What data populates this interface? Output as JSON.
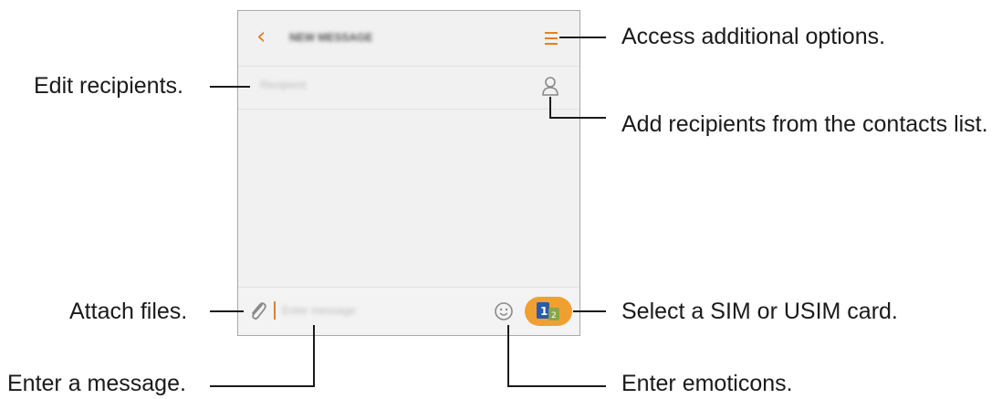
{
  "phone": {
    "header_title": "NEW MESSAGE",
    "recipient_placeholder": "Recipient",
    "message_placeholder": "Enter message",
    "icons": {
      "back": "chevron-left-icon",
      "menu": "menu-icon",
      "contacts": "contact-icon",
      "attach": "paperclip-icon",
      "emoji": "emoticon-icon",
      "sim": "sim-card-icon"
    },
    "accent_color": "#e57f24",
    "sim_button_color": "#f0a030"
  },
  "callouts": {
    "options": "Access additional options.",
    "edit_recipients": "Edit recipients.",
    "add_recipients": "Add recipients from the contacts list.",
    "attach": "Attach files.",
    "sim": "Select a SIM or USIM card.",
    "message": "Enter a message.",
    "emoticons": "Enter emoticons."
  }
}
